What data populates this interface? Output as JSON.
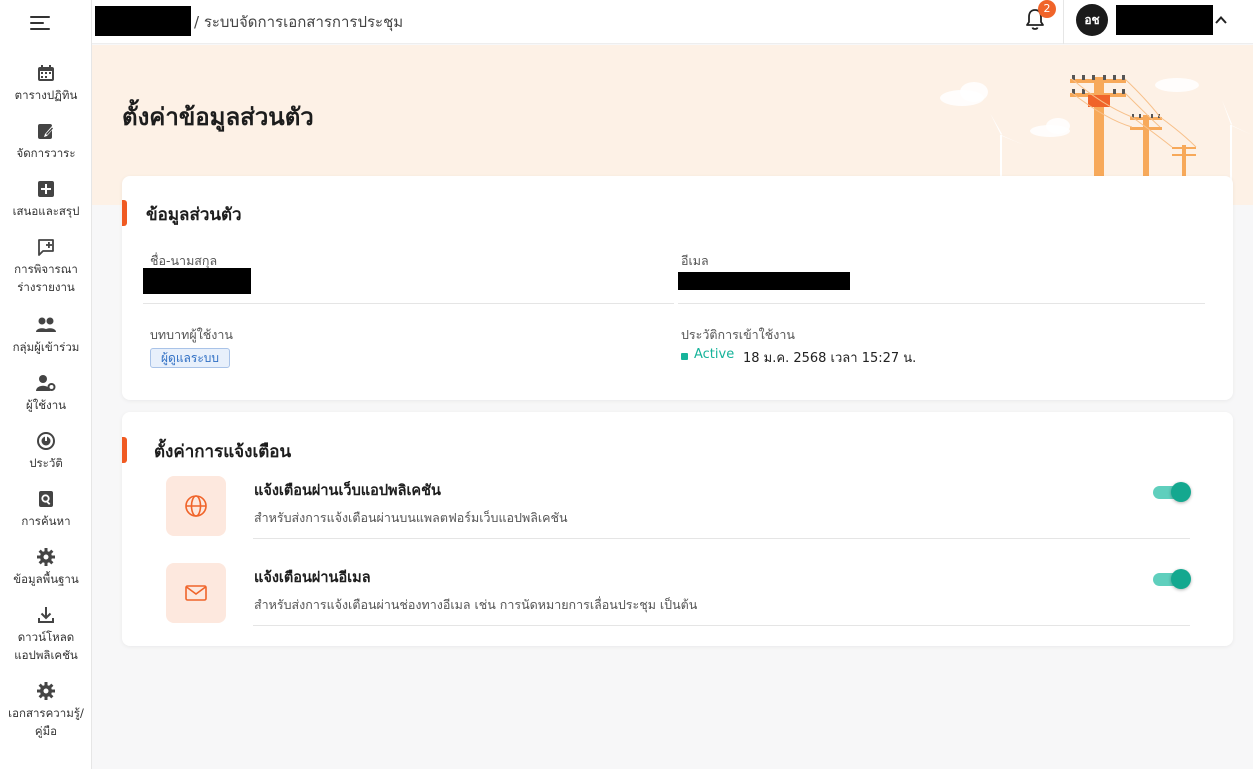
{
  "breadcrumb": {
    "separator_title": "/ ระบบจัดการเอกสารการประชุม"
  },
  "sidebar": {
    "items": [
      {
        "label": "ตารางปฏิทิน",
        "icon": "calendar-icon"
      },
      {
        "label": "จัดการวาระ",
        "icon": "edit-note-icon"
      },
      {
        "label": "เสนอและสรุป",
        "icon": "add-box-icon"
      },
      {
        "label": "การพิจารณา\nร่างรายงาน",
        "icon": "comment-add-icon"
      },
      {
        "label": "กลุ่มผู้เข้าร่วม",
        "icon": "group-icon"
      },
      {
        "label": "ผู้ใช้งาน",
        "icon": "user-gear-icon"
      },
      {
        "label": "ประวัติ",
        "icon": "history-icon"
      },
      {
        "label": "การค้นหา",
        "icon": "search-file-icon"
      },
      {
        "label": "ข้อมูลพื้นฐาน",
        "icon": "gear-icon"
      },
      {
        "label": "ดาวน์โหลด\nแอปพลิเคชัน",
        "icon": "download-icon"
      },
      {
        "label": "เอกสารความรู้/\nคู่มือ",
        "icon": "gear-icon"
      }
    ]
  },
  "header": {
    "notification_count": "2",
    "avatar_initials": "อช"
  },
  "page": {
    "title": "ตั้งค่าข้อมูลส่วนตัว"
  },
  "profile": {
    "section_title": "ข้อมูลส่วนตัว",
    "name_label": "ชื่อ-นามสกุล",
    "email_label": "อีเมล",
    "role_label": "บทบาทผู้ใช้งาน",
    "role_value": "ผู้ดูแลระบบ",
    "login_history_label": "ประวัติการเข้าใช้งาน",
    "status": "Active",
    "last_login": "18 ม.ค. 2568 เวลา 15:27 น."
  },
  "notifications": {
    "section_title": "ตั้งค่าการแจ้งเตือน",
    "items": [
      {
        "title": "แจ้งเตือนผ่านเว็บแอปพลิเคชัน",
        "desc": "สำหรับส่งการแจ้งเตือนผ่านบนแพลตฟอร์มเว็บแอปพลิเคชัน",
        "icon": "globe-icon",
        "enabled": true
      },
      {
        "title": "แจ้งเตือนผ่านอีเมล",
        "desc": "สำหรับส่งการแจ้งเตือนผ่านช่องทางอีเมล เช่น การนัดหมายการเลื่อนประชุม เป็นต้น",
        "icon": "mail-icon",
        "enabled": true
      }
    ]
  },
  "colors": {
    "accent": "#f05a22",
    "teal": "#14a88f",
    "banner": "#fdf1e6"
  }
}
